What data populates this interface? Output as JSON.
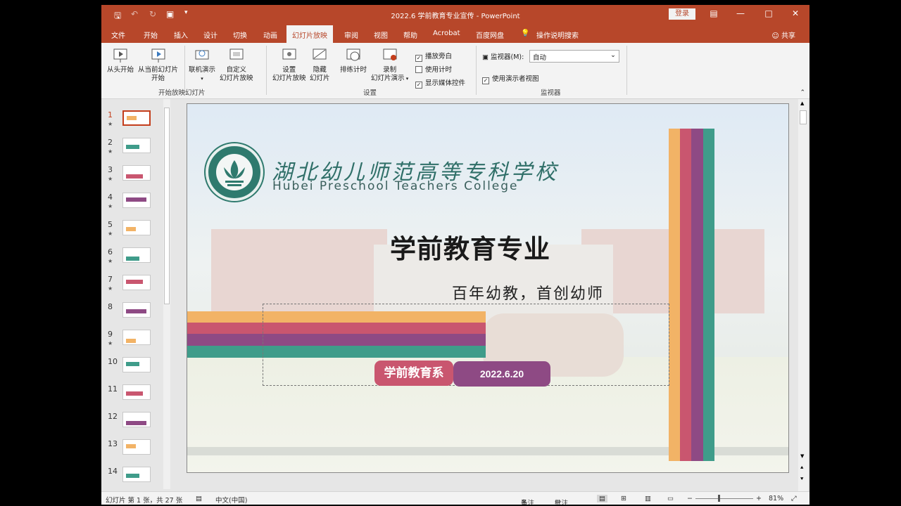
{
  "window": {
    "title": "2022.6 学前教育专业宣传 - PowerPoint",
    "login_label": "登录"
  },
  "tabs": [
    {
      "label": "文件"
    },
    {
      "label": "开始"
    },
    {
      "label": "插入"
    },
    {
      "label": "设计"
    },
    {
      "label": "切换"
    },
    {
      "label": "动画"
    },
    {
      "label": "幻灯片放映"
    },
    {
      "label": "审阅"
    },
    {
      "label": "视图"
    },
    {
      "label": "帮助"
    },
    {
      "label": "Acrobat"
    },
    {
      "label": "百度网盘"
    },
    {
      "label": "操作说明搜索"
    }
  ],
  "share_label": "共享",
  "ribbon": {
    "from_beginning": "从头开始",
    "from_current_1": "从当前幻灯片",
    "from_current_2": "开始",
    "online": "联机演示",
    "custom_1": "自定义",
    "custom_2": "幻灯片放映",
    "group_start": "开始放映幻灯片",
    "setup_1": "设置",
    "setup_2": "幻灯片放映",
    "hide_1": "隐藏",
    "hide_2": "幻灯片",
    "rehearse": "排练计时",
    "record_1": "录制",
    "record_2": "幻灯片演示",
    "play_narration": "播放旁白",
    "use_timings": "使用计时",
    "show_media": "显示媒体控件",
    "group_setup": "设置",
    "monitor_label": "监视器(M):",
    "monitor_value": "自动",
    "presenter_view": "使用演示者视图",
    "group_monitor": "监视器"
  },
  "thumbnails": [
    "1",
    "2",
    "3",
    "4",
    "5",
    "6",
    "7",
    "8",
    "9",
    "10",
    "11",
    "12",
    "13",
    "14"
  ],
  "slide": {
    "college_cn": "湖北幼儿师范高等专科学校",
    "college_en": "Hubei Preschool Teachers College",
    "title": "学前教育专业",
    "subtitle": "百年幼教，首创幼师",
    "department": "学前教育系",
    "date": "2022.6.20"
  },
  "status": {
    "slide_info": "幻灯片 第 1 张，共 27 张",
    "language": "中文(中国)",
    "notes": "备注",
    "comments": "批注",
    "zoom": "81%"
  },
  "colors": {
    "brand": "#b7472a",
    "stripe_orange": "#f2b366",
    "stripe_pink": "#c9566f",
    "stripe_purple": "#8e4a84",
    "stripe_teal": "#3f9c8a"
  }
}
